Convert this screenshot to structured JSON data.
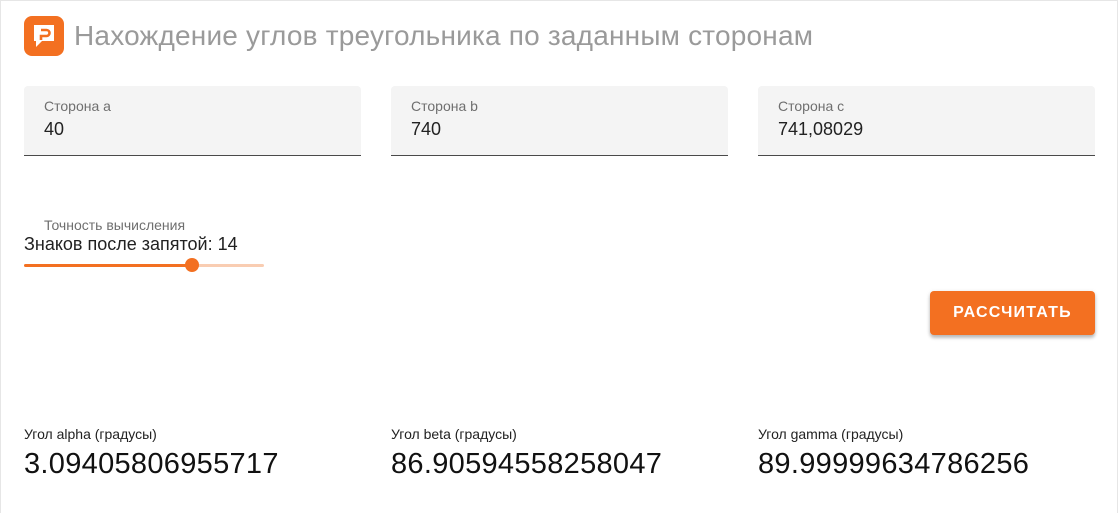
{
  "header": {
    "logo_icon": "orange-chat-logo-icon",
    "title": "Нахождение углов треугольника по заданным сторонам"
  },
  "fields": [
    {
      "label": "Сторона a",
      "value": "40"
    },
    {
      "label": "Сторона b",
      "value": "740"
    },
    {
      "label": "Сторона c",
      "value": "741,08029"
    }
  ],
  "precision": {
    "caption": "Точность вычисления",
    "value_text": "Знаков после запятой: 14",
    "level_fraction": 0.7
  },
  "actions": {
    "calculate_label": "РАССЧИТАТЬ"
  },
  "results": [
    {
      "label": "Угол alpha (градусы)",
      "value": "3.09405806955717"
    },
    {
      "label": "Угол beta (градусы)",
      "value": "86.90594558258047"
    },
    {
      "label": "Угол gamma (градусы)",
      "value": "89.99999634786256"
    }
  ],
  "colors": {
    "accent": "#f37021",
    "title_gray": "#9a9a9a"
  }
}
